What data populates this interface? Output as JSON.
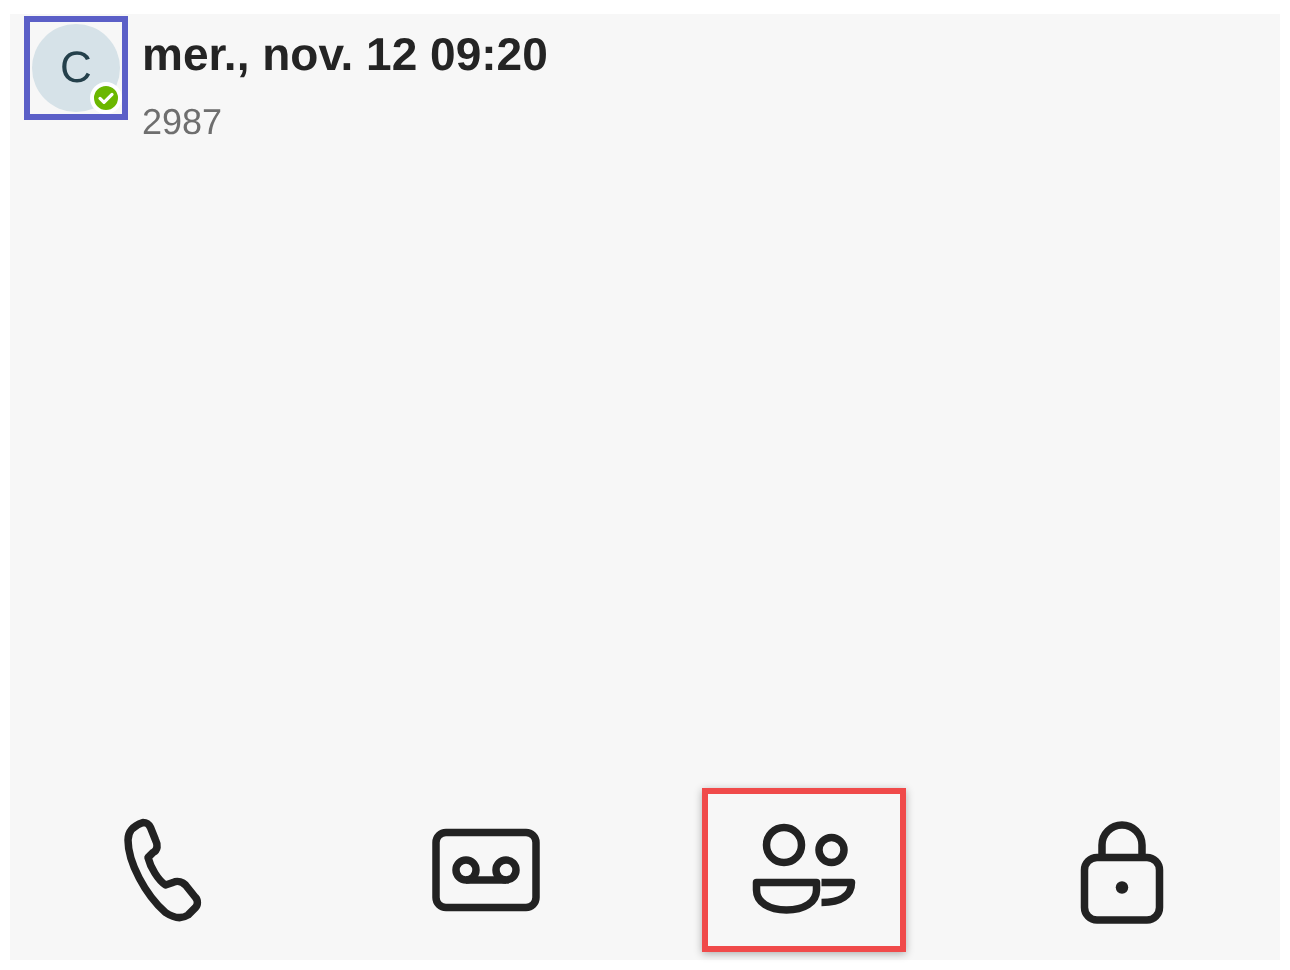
{
  "header": {
    "avatar": {
      "initial": "C",
      "online": true,
      "focused": true
    },
    "title": "mer., nov. 12 09:20",
    "subtitle": "2987"
  },
  "nav": [
    {
      "kind": "phone",
      "selected": false
    },
    {
      "kind": "voicemail",
      "selected": false
    },
    {
      "kind": "contacts",
      "selected": true
    },
    {
      "kind": "lock",
      "selected": false
    }
  ]
}
